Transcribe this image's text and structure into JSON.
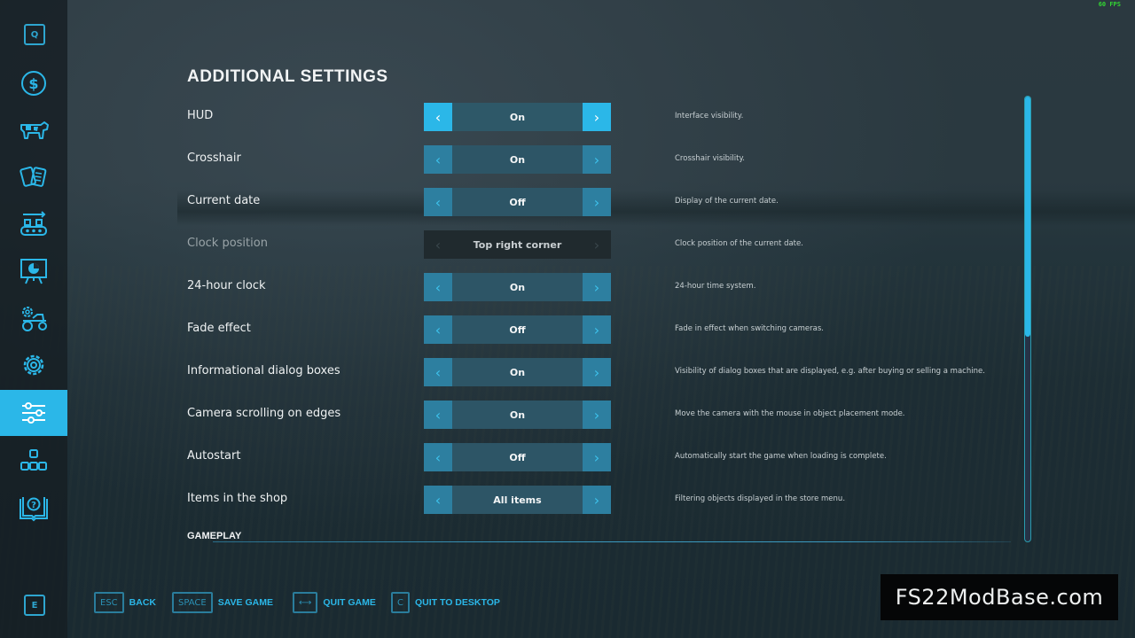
{
  "fps": "60 FPS",
  "sidebar": {
    "top_key": "Q",
    "bottom_key": "E",
    "items": [
      {
        "icon": "dollar-icon",
        "label": "Finances"
      },
      {
        "icon": "cow-icon",
        "label": "Animals"
      },
      {
        "icon": "contracts-icon",
        "label": "Contracts"
      },
      {
        "icon": "production-icon",
        "label": "Production"
      },
      {
        "icon": "statistics-icon",
        "label": "Statistics"
      },
      {
        "icon": "vehicle-settings-icon",
        "label": "Game settings"
      },
      {
        "icon": "gear-icon",
        "label": "General settings"
      },
      {
        "icon": "sliders-icon",
        "label": "Additional settings",
        "active": true
      },
      {
        "icon": "hierarchy-icon",
        "label": "Controls"
      },
      {
        "icon": "help-book-icon",
        "label": "Help"
      }
    ]
  },
  "page": {
    "title": "ADDITIONAL SETTINGS",
    "settings": [
      {
        "label": "HUD",
        "value": "On",
        "description": "Interface visibility.",
        "state": "focused"
      },
      {
        "label": "Crosshair",
        "value": "On",
        "description": "Crosshair visibility.",
        "state": "normal"
      },
      {
        "label": "Current date",
        "value": "Off",
        "description": "Display of the current date.",
        "state": "normal"
      },
      {
        "label": "Clock position",
        "value": "Top right corner",
        "description": "Clock position of the current date.",
        "state": "disabled"
      },
      {
        "label": "24-hour clock",
        "value": "On",
        "description": "24-hour time system.",
        "state": "normal"
      },
      {
        "label": "Fade effect",
        "value": "Off",
        "description": "Fade in effect when switching cameras.",
        "state": "normal"
      },
      {
        "label": "Informational dialog boxes",
        "value": "On",
        "description": "Visibility of dialog boxes that are displayed, e.g. after buying or selling a machine.",
        "state": "normal"
      },
      {
        "label": "Camera scrolling on edges",
        "value": "On",
        "description": "Move the camera with the mouse in object placement mode.",
        "state": "normal"
      },
      {
        "label": "Autostart",
        "value": "Off",
        "description": "Automatically start the game when loading is complete.",
        "state": "normal"
      },
      {
        "label": "Items in the shop",
        "value": "All items",
        "description": "Filtering objects displayed in the store menu.",
        "state": "normal"
      }
    ],
    "next_section": "GAMEPLAY",
    "arrow_left": "‹",
    "arrow_right": "›"
  },
  "scrollbar": {
    "position_fraction": 0.0,
    "visible_fraction": 0.54
  },
  "footer": {
    "hints": [
      {
        "key": "ESC",
        "label": "BACK"
      },
      {
        "key": "SPACE",
        "label": "SAVE GAME"
      },
      {
        "key": "⟷",
        "label": "QUIT GAME"
      },
      {
        "key": "C",
        "label": "QUIT TO DESKTOP"
      }
    ]
  },
  "watermark": "FS22ModBase.com",
  "colors": {
    "accent": "#2bb7e8",
    "selector_bg": "#2d5566",
    "arrow_bg": "#2d7fa0",
    "sidebar_bg": "#161e23"
  }
}
